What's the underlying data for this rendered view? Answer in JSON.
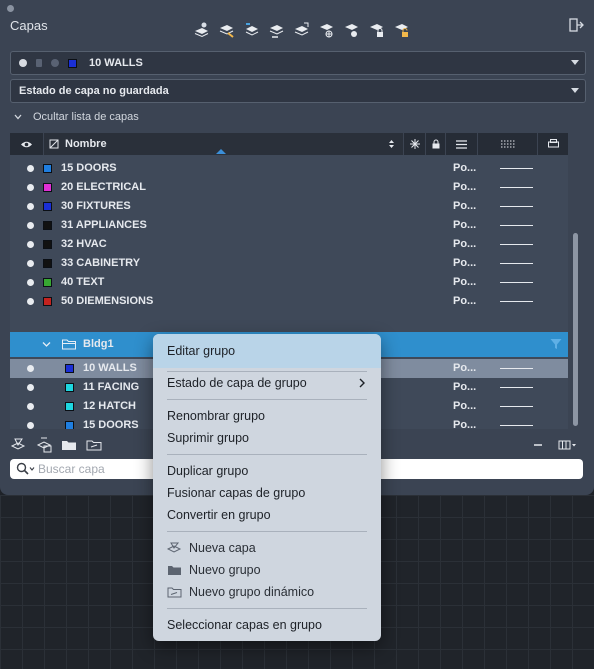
{
  "panel": {
    "title": "Capas",
    "current_layer": {
      "name": "10 WALLS",
      "color": "#1a2fd6"
    },
    "layer_state": "Estado de capa no guardada",
    "hide_list_label": "Ocultar lista de capas"
  },
  "columns": {
    "name_header": "Nombre"
  },
  "layers": [
    {
      "name": "15 DOORS",
      "color": "#1f7ee0",
      "plot": "Po..."
    },
    {
      "name": "20 ELECTRICAL",
      "color": "#e02fd6",
      "plot": "Po..."
    },
    {
      "name": "30 FIXTURES",
      "color": "#1a2fd6",
      "plot": "Po..."
    },
    {
      "name": "31 APPLIANCES",
      "color": "#111111",
      "plot": "Po..."
    },
    {
      "name": "32 HVAC",
      "color": "#111111",
      "plot": "Po..."
    },
    {
      "name": "33 CABINETRY",
      "color": "#111111",
      "plot": "Po..."
    },
    {
      "name": "40 TEXT",
      "color": "#37a832",
      "plot": "Po..."
    },
    {
      "name": "50 DIEMENSIONS",
      "color": "#c4231f",
      "plot": "Po..."
    }
  ],
  "group": {
    "name": "Bldg1",
    "layers": [
      {
        "name": "10 WALLS",
        "color": "#1a2fd6",
        "plot": "Po..."
      },
      {
        "name": "11 FACING",
        "color": "#1ed6e0",
        "plot": "Po..."
      },
      {
        "name": "12 HATCH",
        "color": "#1ed6e0",
        "plot": "Po..."
      },
      {
        "name": "15 DOORS",
        "color": "#1f7ee0",
        "plot": "Po..."
      }
    ]
  },
  "search": {
    "placeholder": "Buscar capa"
  },
  "context_menu": {
    "edit_group": "Editar grupo",
    "group_layer_state": "Estado de capa de grupo",
    "rename_group": "Renombrar grupo",
    "delete_group": "Suprimir grupo",
    "duplicate_group": "Duplicar grupo",
    "merge_group_layers": "Fusionar capas de grupo",
    "convert_to_group": "Convertir en grupo",
    "new_layer": "Nueva capa",
    "new_group": "Nuevo grupo",
    "new_dynamic_group": "Nuevo grupo dinámico",
    "select_layers_in_group": "Seleccionar capas en grupo"
  }
}
